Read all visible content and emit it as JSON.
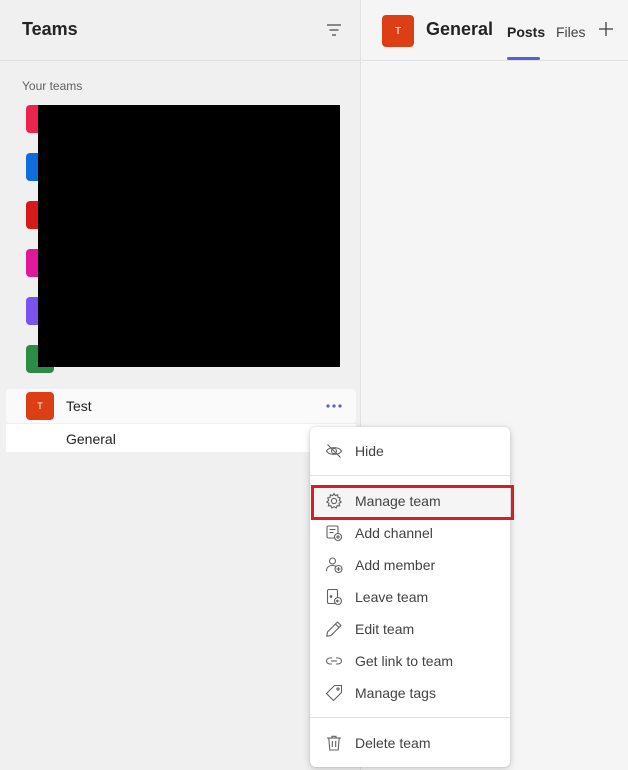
{
  "left_panel": {
    "title": "Teams",
    "section_label": "Your teams",
    "team_tile_colors": [
      "#e8244f",
      "#0f6cda",
      "#d61a1a",
      "#e0189a",
      "#7a52ee",
      "#2e8b47"
    ],
    "team": {
      "avatar_letter": "T",
      "name": "Test",
      "channel": "General"
    }
  },
  "header": {
    "avatar_letter": "T",
    "channel_title": "General",
    "tabs": [
      "Posts",
      "Files"
    ],
    "active_tab": "Posts"
  },
  "menu": {
    "items": [
      {
        "label": "Hide",
        "icon": "hide-icon"
      },
      {
        "label": "Manage team",
        "icon": "gear-icon"
      },
      {
        "label": "Add channel",
        "icon": "add-channel-icon"
      },
      {
        "label": "Add member",
        "icon": "add-member-icon"
      },
      {
        "label": "Leave team",
        "icon": "leave-team-icon"
      },
      {
        "label": "Edit team",
        "icon": "pencil-icon"
      },
      {
        "label": "Get link to team",
        "icon": "link-icon"
      },
      {
        "label": "Manage tags",
        "icon": "tag-icon"
      },
      {
        "label": "Delete team",
        "icon": "trash-icon"
      }
    ],
    "highlighted": "Manage team"
  },
  "colors": {
    "accent": "#5b5fc7",
    "team_avatar": "#dc3e15",
    "highlight_border": "#d41f27"
  }
}
